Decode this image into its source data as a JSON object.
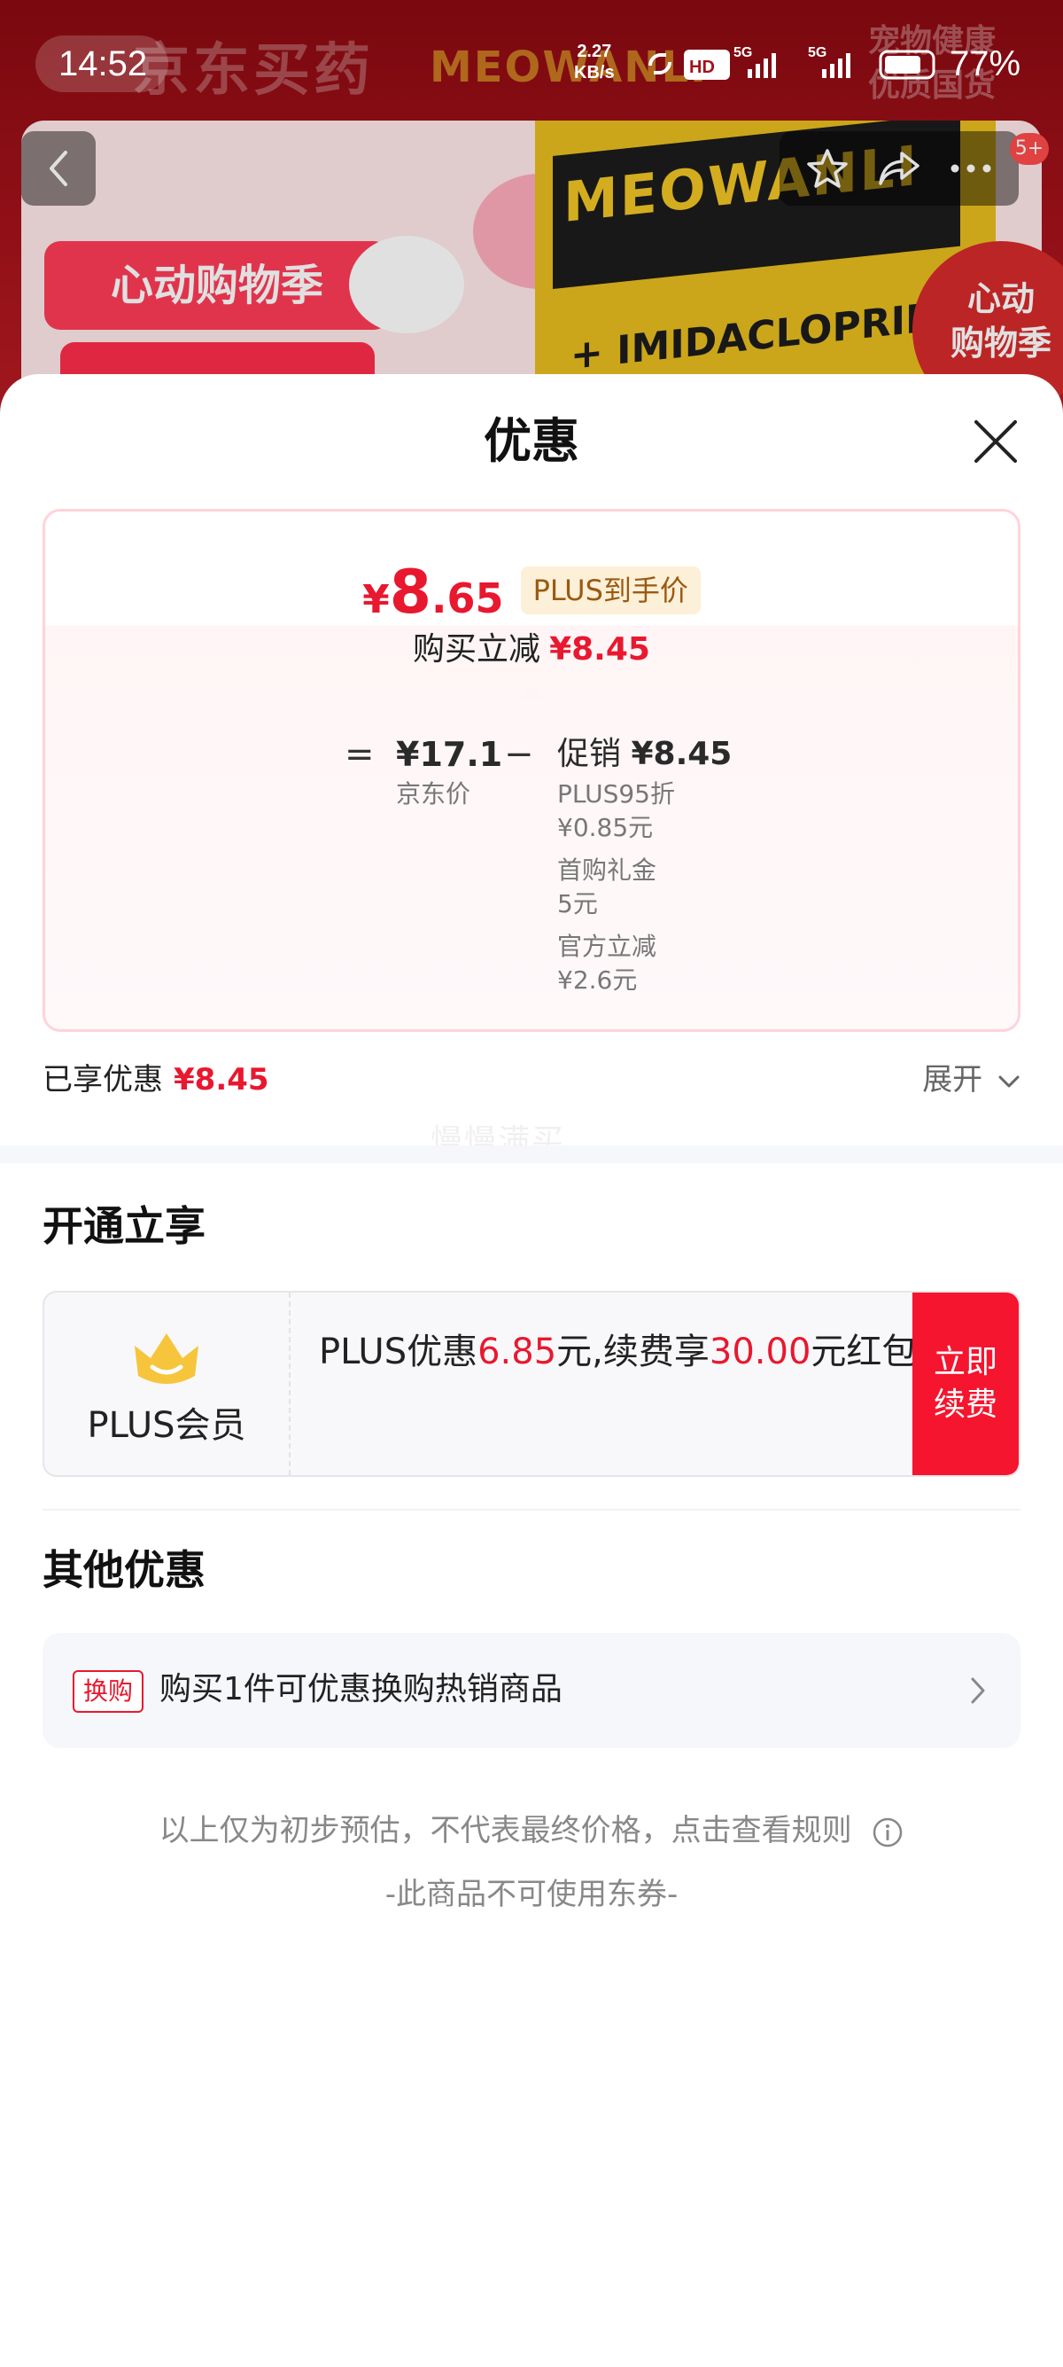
{
  "status_bar": {
    "time": "14:52",
    "net_speed_value": "2.27",
    "net_speed_unit": "KB/s",
    "battery": "77%"
  },
  "background_page": {
    "header_text": "京东买药",
    "brand_text": "MEOWANLI",
    "corner_text_line1": "宠物健康",
    "corner_text_line2": "优质国货",
    "banner_text": "心动购物季",
    "product_brand": "MEOWANLI",
    "product_ingredient": "+ IMIDACLOPRID AN",
    "badge_line1": "心动",
    "badge_line2": "购物季",
    "message_count": "5+"
  },
  "sheet": {
    "title": "优惠",
    "price_card": {
      "final_price_symbol": "¥",
      "final_price_int": "8",
      "final_price_dec": ".65",
      "price_tag": "PLUS到手价",
      "discount_label": "购买立减",
      "discount_value": "¥8.45",
      "equals": "=",
      "jd_price_value": "¥17.1",
      "jd_price_label": "京东价",
      "minus": "−",
      "promo_label": "促销",
      "promo_value": "¥8.45",
      "promo_items": [
        {
          "name": "PLUS95折",
          "amount": "¥0.85元"
        },
        {
          "name": "首购礼金",
          "amount": "5元"
        },
        {
          "name": "官方立减",
          "amount": "¥2.6元"
        }
      ]
    },
    "enjoyed": {
      "label": "已享优惠",
      "value": "¥8.45"
    },
    "expand_label": "展开",
    "watermark": "慢慢满买",
    "open_section": {
      "title": "开通立享",
      "member_name": "PLUS会员",
      "desc_prefix": "PLUS优惠",
      "desc_value1": "6.85",
      "desc_mid": "元,续费享",
      "desc_value2": "30.00",
      "desc_suffix": "元红包",
      "button_line1": "立即",
      "button_line2": "续费"
    },
    "other_section": {
      "title": "其他优惠",
      "tag": "换购",
      "text": "购买1件可优惠换购热销商品"
    },
    "footer_note": "以上仅为初步预估，不代表最终价格，点击查看规则",
    "footer_sub": "-此商品不可使用东券-"
  },
  "colors": {
    "accent_red": "#e8182f",
    "renew_button": "#f5152e",
    "plus_tag_bg": "#fdf0d8",
    "plus_tag_text": "#9a5a12",
    "crown_yellow": "#f6c53c"
  }
}
